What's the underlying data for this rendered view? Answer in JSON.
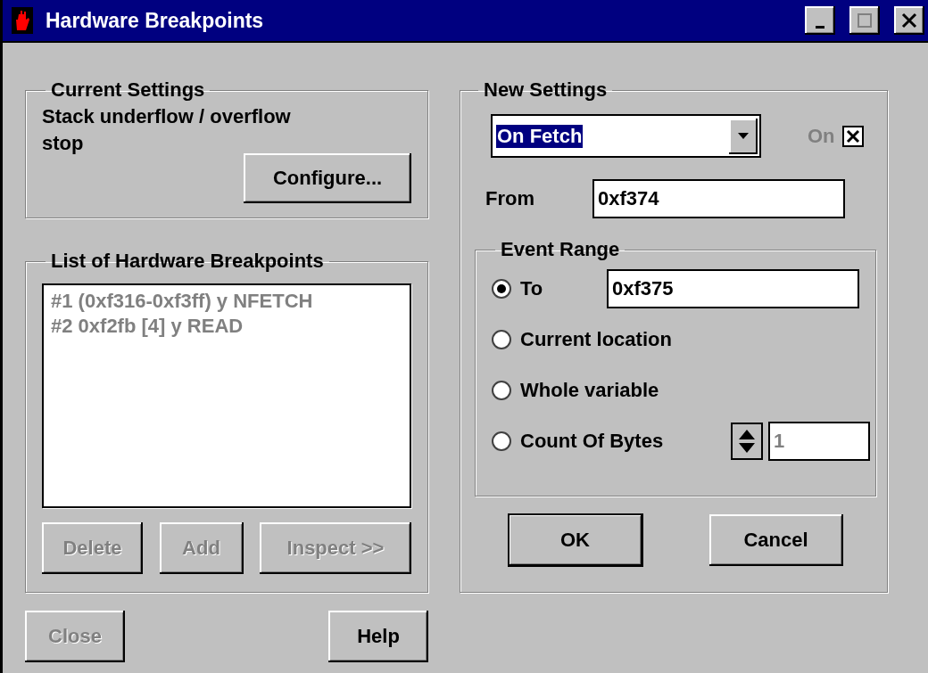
{
  "window": {
    "title": "Hardware Breakpoints"
  },
  "current_settings": {
    "title": "Current Settings",
    "text": "Stack underflow / overflow stop",
    "button": {
      "label": "Configure...",
      "disabled": false
    }
  },
  "breakpoint_list": {
    "title": "List of Hardware Breakpoints",
    "disabled": true,
    "items": [
      {
        "label": "#1 (0xf316-0xf3ff) y NFETCH"
      },
      {
        "label": "#2 0xf2fb [4] y READ"
      }
    ],
    "buttons": [
      {
        "label": "Delete",
        "disabled": true
      },
      {
        "label": "Add",
        "disabled": true
      },
      {
        "label": "Inspect >>",
        "disabled": true
      }
    ]
  },
  "footer_buttons": [
    {
      "label": "Close",
      "disabled": true
    },
    {
      "label": "Help",
      "disabled": false
    }
  ],
  "new_settings": {
    "title": "New Settings",
    "trigger": {
      "value": "On Fetch",
      "highlighted": true
    },
    "on_checkbox": {
      "label": "On",
      "checked": true,
      "disabled": true
    },
    "from": {
      "label": "From",
      "value": "0xf374"
    },
    "event_range": {
      "title": "Event Range",
      "options": [
        {
          "kind": "field",
          "label": "To",
          "selected": true,
          "value": "0xf375"
        },
        {
          "kind": "plain",
          "label": "Current location",
          "selected": false
        },
        {
          "kind": "plain",
          "label": "Whole variable",
          "selected": false
        },
        {
          "kind": "spinner",
          "label": "Count Of Bytes",
          "selected": false,
          "value": "1",
          "disabled": true
        }
      ]
    },
    "buttons": [
      {
        "label": "OK",
        "default": true
      },
      {
        "label": "Cancel",
        "default": false
      }
    ]
  }
}
